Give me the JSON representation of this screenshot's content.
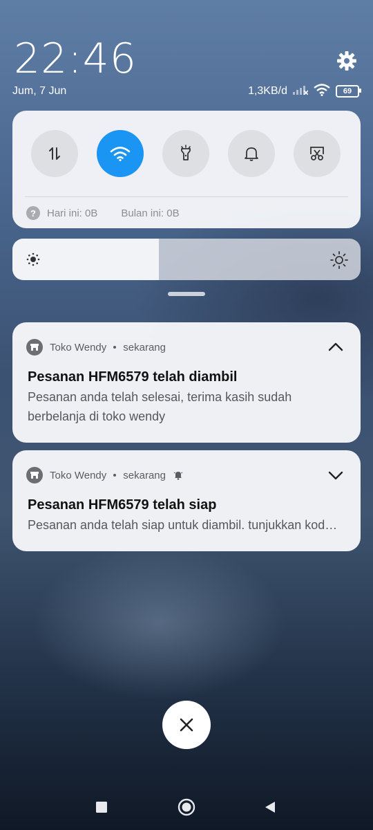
{
  "status": {
    "time": "22:46",
    "date": "Jum, 7 Jun",
    "data_speed": "1,3KB/d",
    "battery": "69"
  },
  "quick_settings": {
    "tiles": [
      {
        "name": "mobile-data",
        "icon": "data-arrows-icon",
        "active": false
      },
      {
        "name": "wifi",
        "icon": "wifi-icon",
        "active": true
      },
      {
        "name": "flashlight",
        "icon": "flashlight-icon",
        "active": false
      },
      {
        "name": "silent",
        "icon": "bell-icon",
        "active": false
      },
      {
        "name": "screenshot",
        "icon": "scissors-icon",
        "active": false
      }
    ],
    "usage_today": "Hari ini: 0B",
    "usage_month": "Bulan ini: 0B",
    "help_glyph": "?",
    "accent": "#1b95f3"
  },
  "brightness": {
    "level": 0.42
  },
  "notifications": [
    {
      "app": "Toko Wendy",
      "time": "sekarang",
      "title": "Pesanan HFM6579 telah diambil",
      "body": "Pesanan anda telah selesai, terima kasih sudah berbelanja di toko wendy",
      "expanded": true
    },
    {
      "app": "Toko Wendy",
      "time": "sekarang",
      "title": "Pesanan HFM6579 telah siap",
      "body": "Pesanan anda telah siap untuk diambil. tunjukkan kode pesanan kepada kasir",
      "expanded": false,
      "has_alert_icon": true
    }
  ],
  "nav": [
    "recents-icon",
    "home-icon",
    "back-icon"
  ]
}
